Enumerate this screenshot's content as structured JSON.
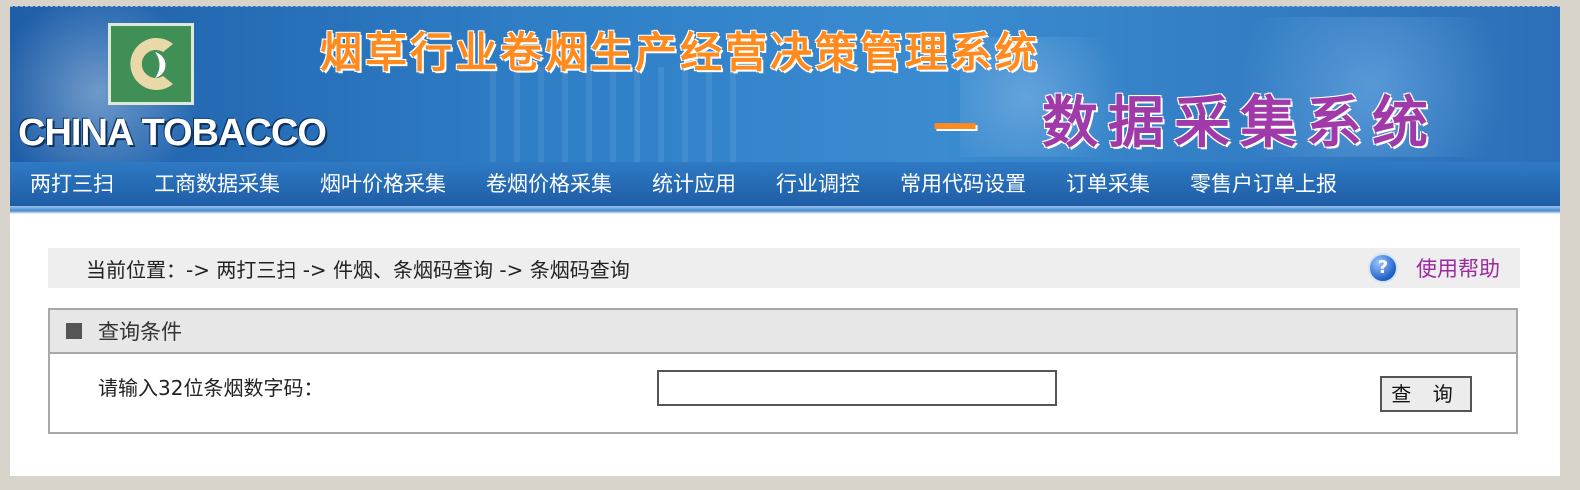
{
  "banner": {
    "brand_text": "CHINA TOBACCO",
    "title_main": "烟草行业卷烟生产经营决策管理系统",
    "title_dash": "—",
    "title_sub": "数据采集系统",
    "logo_icon": "china-tobacco-logo-icon",
    "colors": {
      "banner": "#2f7fc7",
      "title_main": "#ff8a1e",
      "title_sub": "#a03aa8",
      "logo": "#3f8f57"
    }
  },
  "nav": {
    "items": [
      {
        "label": "两打三扫"
      },
      {
        "label": "工商数据采集"
      },
      {
        "label": "烟叶价格采集"
      },
      {
        "label": "卷烟价格采集"
      },
      {
        "label": "统计应用"
      },
      {
        "label": "行业调控"
      },
      {
        "label": "常用代码设置"
      },
      {
        "label": "订单采集"
      },
      {
        "label": "零售户订单上报"
      }
    ]
  },
  "breadcrumb": {
    "text": "当前位置：-> 两打三扫 -> 件烟、条烟码查询 -> 条烟码查询",
    "help_label": "使用帮助",
    "help_icon": "help-question-icon",
    "help_icon_glyph": "?"
  },
  "query": {
    "title": "查询条件",
    "input_label": "请输入32位条烟数字码：",
    "input_value": "",
    "button_label": "查 询"
  }
}
